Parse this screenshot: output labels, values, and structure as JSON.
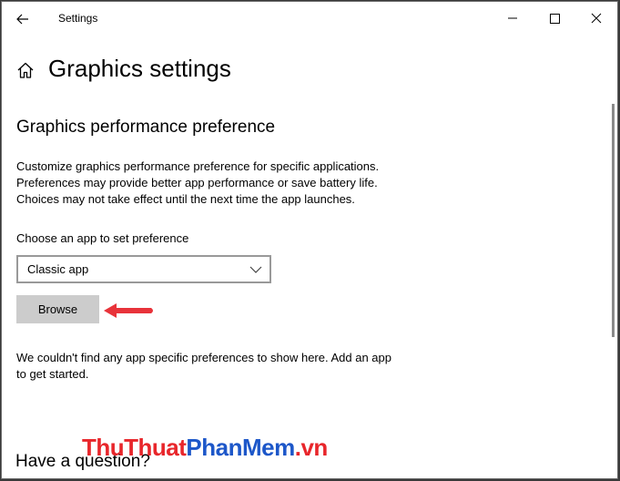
{
  "window": {
    "title": "Settings"
  },
  "page": {
    "title": "Graphics settings",
    "section_title": "Graphics performance preference",
    "description_lines": [
      "Customize graphics performance preference for specific applications.",
      "Preferences may provide better app performance or save battery life.",
      "Choices may not take effect until the next time the app launches."
    ],
    "choose_label": "Choose an app to set preference",
    "select_value": "Classic app",
    "browse_label": "Browse",
    "empty_lines": [
      "We couldn't find any app specific preferences to show here. Add an app",
      "to get started."
    ],
    "help_title": "Have a question?"
  },
  "watermark": {
    "part1": "ThuThuat",
    "part2": "PhanMem",
    "part3": ".vn"
  },
  "colors": {
    "arrow": "#e8333a",
    "watermark_red": "#e8262b",
    "watermark_blue": "#1d57c9"
  }
}
